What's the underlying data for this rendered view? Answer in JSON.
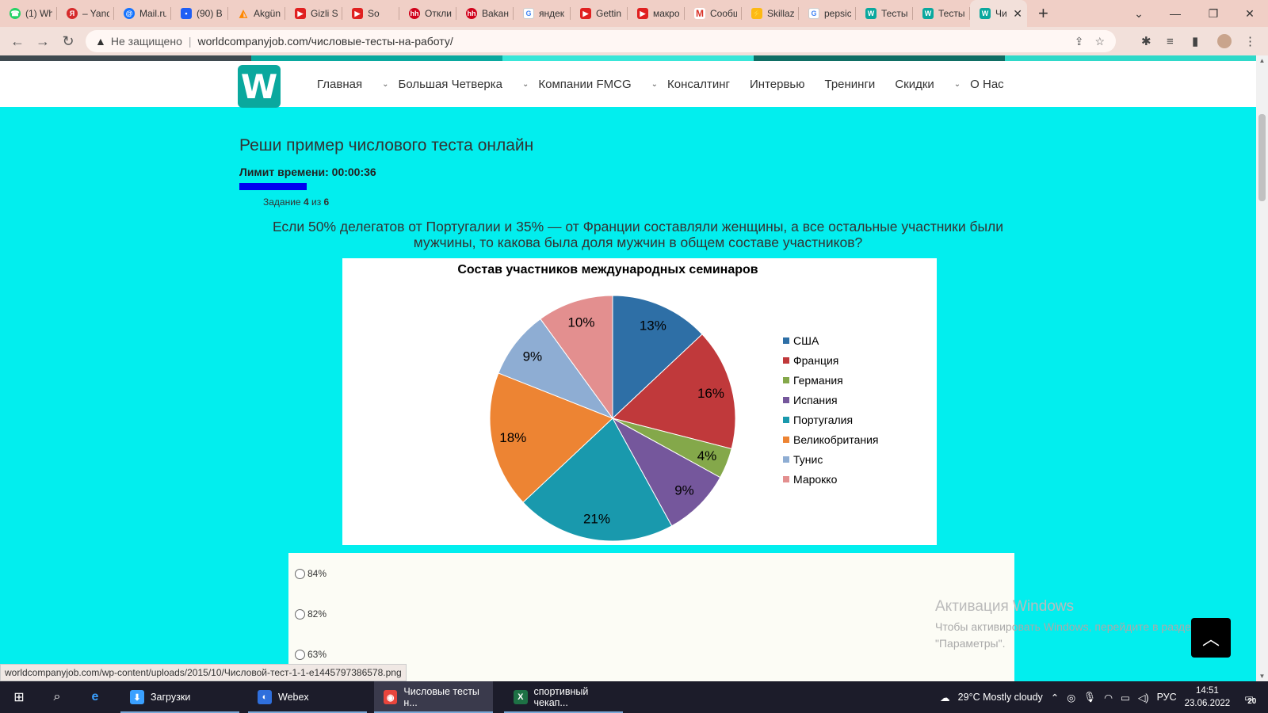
{
  "browser": {
    "tabs": [
      {
        "title": "(1) Wh",
        "icon": "whatsapp-icon",
        "color": "#25d366"
      },
      {
        "title": "– Yand",
        "icon": "yandex-icon",
        "color": "#d62b2b"
      },
      {
        "title": "Mail.ru",
        "icon": "mail-icon",
        "color": "#1573ff"
      },
      {
        "title": "(90) B",
        "icon": "chat-icon",
        "color": "#1f5ef5"
      },
      {
        "title": "Akgün",
        "icon": "akgun-icon",
        "color": "#ff8800"
      },
      {
        "title": "Gizli S",
        "icon": "youtube-icon",
        "color": "#e02020"
      },
      {
        "title": "So",
        "icon": "youtube-icon",
        "color": "#e02020"
      },
      {
        "title": "Откли",
        "icon": "hh-icon",
        "color": "#d0021b"
      },
      {
        "title": "Ваkан",
        "icon": "hh-icon",
        "color": "#d0021b"
      },
      {
        "title": "яндек",
        "icon": "google-icon",
        "color": "#4285f4"
      },
      {
        "title": "Gettin",
        "icon": "youtube-icon",
        "color": "#e02020"
      },
      {
        "title": "макро",
        "icon": "youtube-icon",
        "color": "#e02020"
      },
      {
        "title": "Сообщ",
        "icon": "gmail-icon",
        "color": "#d93025"
      },
      {
        "title": "Skillaz",
        "icon": "skillaz-icon",
        "color": "#fdb913"
      },
      {
        "title": "pepsic",
        "icon": "google-icon",
        "color": "#4285f4"
      },
      {
        "title": "Тесты",
        "icon": "w-icon",
        "color": "#0aa89e"
      },
      {
        "title": "Тесты",
        "icon": "w-icon",
        "color": "#0aa89e"
      },
      {
        "title": "Чи",
        "icon": "w-icon",
        "color": "#0aa89e",
        "active": true
      }
    ],
    "security_label": "Не защищено",
    "url": "worldcompanyjob.com/числовые-тесты-на-работу/"
  },
  "site": {
    "logo_letter": "W",
    "menu": [
      {
        "label": "Главная",
        "dropdown": false
      },
      {
        "label": "Большая Четверка",
        "dropdown": true
      },
      {
        "label": "Компании FMCG",
        "dropdown": true
      },
      {
        "label": "Консалтинг",
        "dropdown": true
      },
      {
        "label": "Интервью",
        "dropdown": false
      },
      {
        "label": "Тренинги",
        "dropdown": false
      },
      {
        "label": "Скидки",
        "dropdown": false
      },
      {
        "label": "О Нас",
        "dropdown": true
      }
    ],
    "stripe_colors": [
      "#3f4a50",
      "#0aa89e",
      "#39e6d8",
      "#0f6e64",
      "#2fd9c9"
    ],
    "page_bg": "#02eeee"
  },
  "quiz": {
    "title": "Реши пример числового теста онлайн",
    "timer_label": "Лимит времени:",
    "timer_value": "00:00:36",
    "progress_fraction": 0.667,
    "task_label": "Задание",
    "task_current": "4",
    "task_of": "из",
    "task_total": "6",
    "question": "Если 50% делегатов от Португалии и 35% — от Франции составляли женщины, а все остальные участники были мужчины, то какова была доля мужчин в общем составе участников?",
    "options": [
      "84%",
      "82%",
      "63%"
    ]
  },
  "chart_data": {
    "type": "pie",
    "title": "Состав участников международных семинаров",
    "categories": [
      "США",
      "Франция",
      "Германия",
      "Испания",
      "Португалия",
      "Великобритания",
      "Тунис",
      "Марокко"
    ],
    "values": [
      13,
      16,
      4,
      9,
      21,
      18,
      9,
      10
    ],
    "labels": [
      "13%",
      "16%",
      "4%",
      "9%",
      "21%",
      "18%",
      "9%",
      "10%"
    ],
    "colors": [
      "#2e6fa6",
      "#c0393b",
      "#84a84a",
      "#75579c",
      "#1999ad",
      "#ed8433",
      "#8eadd3",
      "#e38f8f"
    ],
    "legend_position": "right"
  },
  "overlay": {
    "watermark_title": "Активация Windows",
    "watermark_text": "Чтобы активировать Windows, перейдите в раздел \"Параметры\".",
    "status_link": "worldcompanyjob.com/wp-content/uploads/2015/10/Числовой-тест-1-1-e1445797386578.png"
  },
  "taskbar": {
    "apps": [
      {
        "label": "Загрузки",
        "icon": "download-icon"
      },
      {
        "label": "Webex",
        "icon": "webex-icon"
      },
      {
        "label": "Числовые тесты н...",
        "icon": "chrome-icon",
        "active": true
      },
      {
        "label": "спортивный чекап...",
        "icon": "excel-icon"
      }
    ],
    "weather": "29°C  Mostly cloudy",
    "lang": "РУС",
    "time": "14:51",
    "date": "23.06.2022",
    "notifications": "20"
  }
}
